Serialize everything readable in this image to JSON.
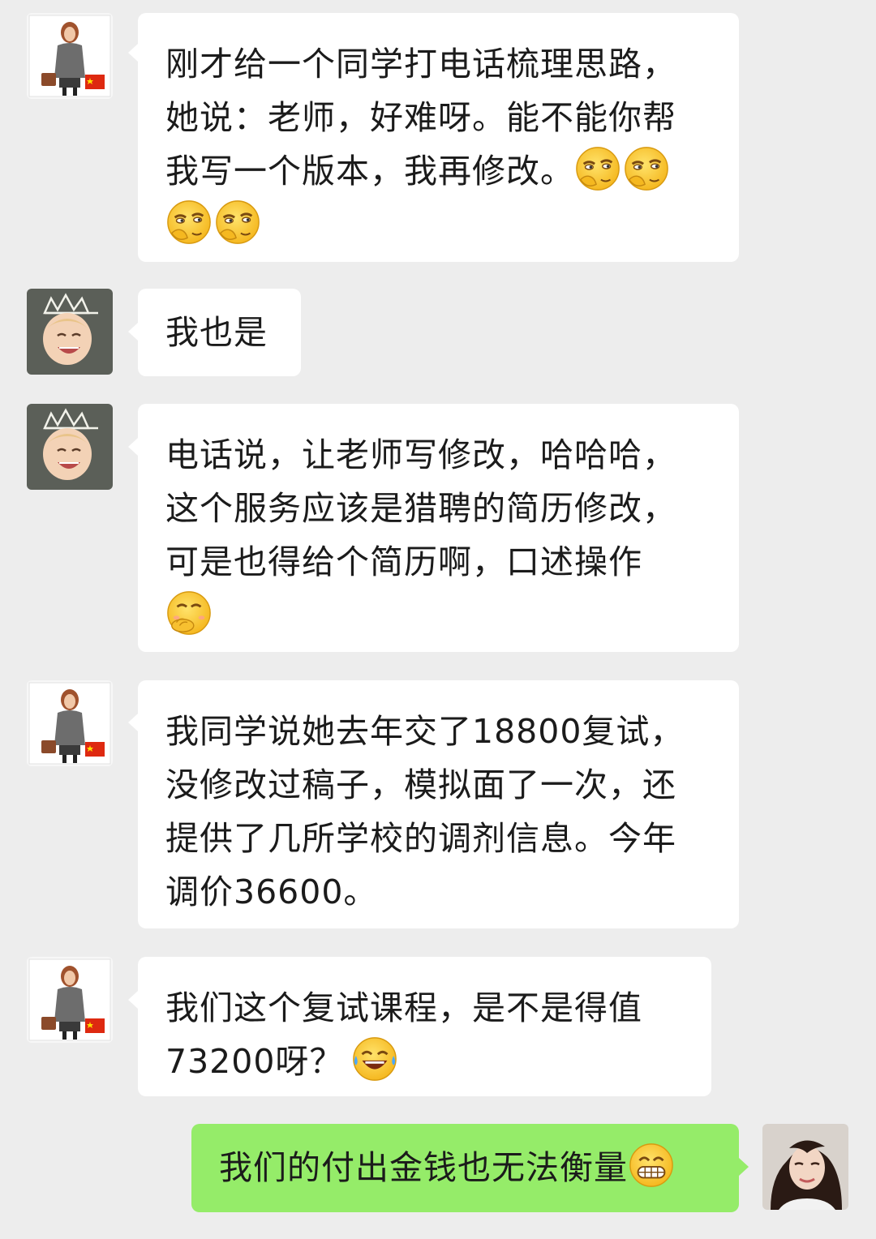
{
  "messages": [
    {
      "sender": "girl-avatar",
      "lines": [
        "刚才给一个同学打电话梳理思路，",
        "她说：老师，好难呀。能不能你帮",
        "我写一个版本，我再修改。"
      ],
      "trailing_emoji": [
        "smirk-covering-mouth",
        "smirk-covering-mouth",
        "smirk-covering-mouth",
        "smirk-covering-mouth"
      ]
    },
    {
      "sender": "baby-crown-avatar",
      "lines": [
        "我也是"
      ]
    },
    {
      "sender": "baby-crown-avatar",
      "lines": [
        "电话说，让老师写修改，哈哈哈，",
        "这个服务应该是猎聘的简历修改，",
        "可是也得给个简历啊，口述操作"
      ],
      "trailing_emoji": [
        "hand-over-mouth"
      ]
    },
    {
      "sender": "girl-avatar",
      "lines": [
        "我同学说她去年交了18800复试，",
        "没修改过稿子，模拟面了一次，还",
        "提供了几所学校的调剂信息。今年",
        "调价36600。"
      ]
    },
    {
      "sender": "girl-avatar",
      "lines": [
        "我们这个复试课程，是不是得值",
        "73200呀？"
      ],
      "trailing_emoji": [
        "tears-of-joy"
      ]
    },
    {
      "sender": "self-avatar",
      "lines": [
        "我们的付出金钱也无法衡量"
      ],
      "trailing_emoji": [
        "grinning"
      ]
    }
  ],
  "colors": {
    "background": "#ededed",
    "incoming_bubble": "#ffffff",
    "outgoing_bubble": "#95ec69",
    "text": "#1b1b1b"
  }
}
